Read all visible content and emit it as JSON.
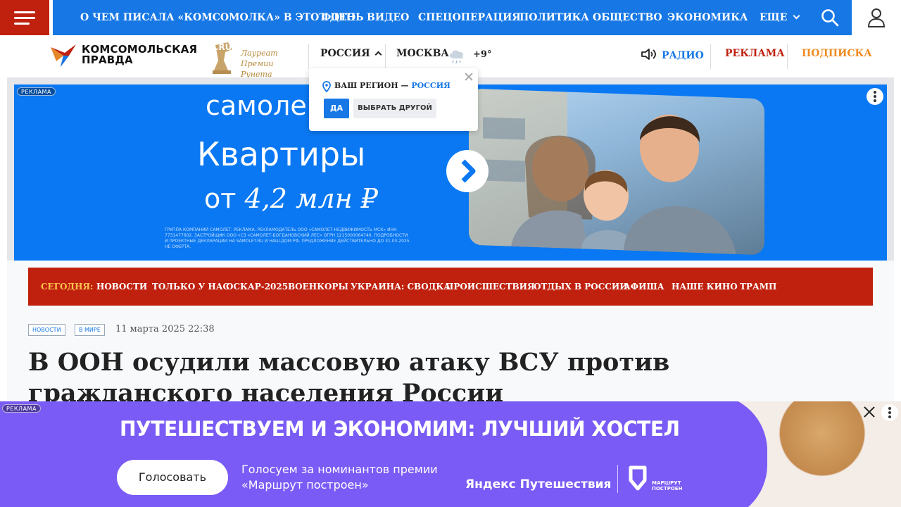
{
  "nav": {
    "items": [
      "О ЧЕМ ПИСАЛА «КОМСОМОЛКА» В ЭТОТ ДЕНЬ",
      "ФОТО",
      "ВИДЕО",
      "СПЕЦОПЕРАЦИЯ",
      "ПОЛИТИКА",
      "ОБЩЕСТВО",
      "ЭКОНОМИКА"
    ],
    "more_label": "ЕЩЕ",
    "menu_icon": "hamburger-icon",
    "search_icon": "search-icon",
    "user_icon": "user-icon",
    "color": "#1677e5",
    "menu_color": "#c0210f"
  },
  "header": {
    "logo_line1": "КОМСОМОЛЬСКАЯ",
    "logo_line2": "ПРАВДА",
    "laureate_badge": ".RU",
    "laureate_line1": "Лауреат",
    "laureate_line2": "Премии Рунета",
    "region": "РОССИЯ",
    "city": "МОСКВА",
    "temperature": "+9°",
    "weather_icon": "cloud-rain-icon",
    "radio_label": "РАДИО",
    "ads_label": "РЕКЛАМА",
    "subscribe_label": "ПОДПИСКА"
  },
  "region_popup": {
    "prefix": "ВАШ РЕГИОН —",
    "region": "РОССИЯ",
    "yes_label": "ДА",
    "other_label": "ВЫБРАТЬ ДРУГОЙ"
  },
  "top_banner": {
    "ad_label": "РЕКЛАМА",
    "brand": "самоле",
    "title": "Квартиры",
    "price_prefix": "от",
    "price": "4,2 млн ₽",
    "fine_print": "ГРУППА КОМПАНИЙ САМОЛЕТ. РЕКЛАМА. РЕКЛАМОДАТЕЛЬ ООО «САМОЛЕТ-НЕДВИЖИМОСТЬ МСК» ИНН 7731477602. ЗАСТРОЙЩИК ООО «СЗ «САМОЛЕТ-БОГДАНОВСКИЙ ЛЕС» ОГРН 1215000064740. ПОДРОБНОСТИ И ПРОЕКТНЫЕ ДЕКЛАРАЦИИ НА SAMOLET.RU И НАШ.ДОМ.РФ. ПРЕДЛОЖЕНИЕ ДЕЙСТВИТЕЛЬНО ДО 31.03.2025. НЕ ОФЕРТА.",
    "color": "#0a78f2"
  },
  "today_bar": {
    "label": "СЕГОДНЯ:",
    "items": [
      "НОВОСТИ",
      "ТОЛЬКО У НАС",
      "ОСКАР-2025",
      "ВОЕНКОРЫ",
      "УКРАИНА: СВОДКА",
      "ПРОИСШЕСТВИЯ",
      "ОТДЫХ В РОССИИ",
      "АФИША",
      "НАШЕ КИНО",
      "ТРАМП"
    ],
    "color": "#c0210f"
  },
  "article": {
    "tags": [
      "НОВОСТИ",
      "В МИРЕ"
    ],
    "date": "11 марта 2025 22:38",
    "headline": "В ООН осудили массовую атаку ВСУ против гражданского населения России"
  },
  "bottom_ad": {
    "ad_label": "РЕКЛАМА",
    "title": "ПУТЕШЕСТВУЕМ И ЭКОНОМИМ: ЛУЧШИЙ ХОСТЕЛ",
    "button_label": "Голосовать",
    "text_line1": "Голосуем за номинантов премии",
    "text_line2": "«Маршрут построен»",
    "yandex_label": "Яндекс Путешествия",
    "partner_line1": "МАРШРУТ",
    "partner_line2": "ПОСТРОЕН",
    "color": "#7a5bf5"
  }
}
